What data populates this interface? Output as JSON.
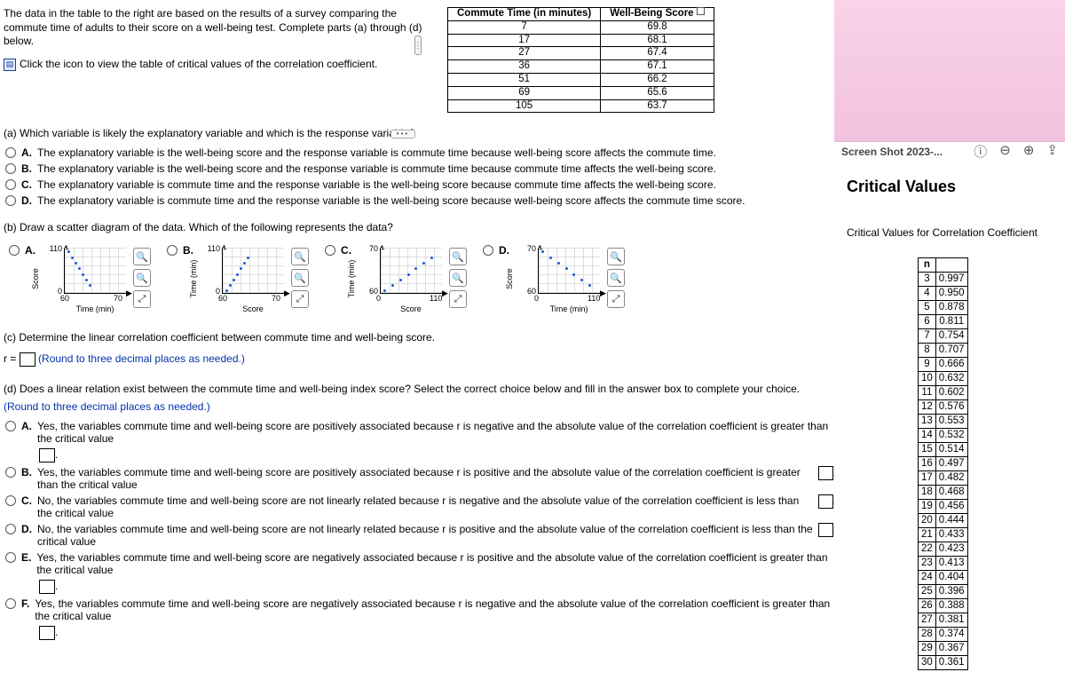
{
  "intro": {
    "line1": "The data in the table to the right are based on the results of a survey comparing the commute time of adults to their score on a well-being test. Complete parts (a) through (d) below.",
    "click_link": "Click the icon to view the table of critical values of the correlation coefficient."
  },
  "data_table": {
    "head_commute": "Commute Time (in minutes)",
    "head_score": "Well-Being Score",
    "rows": [
      {
        "c": "7",
        "s": "69.8"
      },
      {
        "c": "17",
        "s": "68.1"
      },
      {
        "c": "27",
        "s": "67.4"
      },
      {
        "c": "36",
        "s": "67.1"
      },
      {
        "c": "51",
        "s": "66.2"
      },
      {
        "c": "69",
        "s": "65.6"
      },
      {
        "c": "105",
        "s": "63.7"
      }
    ]
  },
  "qa": {
    "prompt": "(a) Which variable is likely the explanatory variable and which is the response variable?",
    "A": "The explanatory variable is the well-being score and the response variable is commute time because well-being score affects the commute time.",
    "B": "The explanatory variable is the well-being score and the response variable is commute time because commute time affects the well-being score.",
    "C": "The explanatory variable is commute time and the response variable is the well-being score because commute time affects the well-being score.",
    "D": "The explanatory variable is commute time and the response variable is the well-being score because well-being score affects the commute time score."
  },
  "qb": {
    "prompt": "(b) Draw a scatter diagram of the data. Which of the following represents the data?",
    "labA": "A.",
    "labB": "B.",
    "labC": "C.",
    "labD": "D.",
    "plotA": {
      "yl": "Score",
      "xl": "Time (min)",
      "yt": "110",
      "yb": "0",
      "xa": "60",
      "xb": "70"
    },
    "plotB": {
      "yl": "Time (min)",
      "xl": "Score",
      "yt": "110",
      "yb": "0",
      "xa": "60",
      "xb": "70"
    },
    "plotC": {
      "yl": "Time (min)",
      "xl": "Score",
      "yt": "70",
      "yb": "60",
      "xa": "0",
      "xb": "110"
    },
    "plotD": {
      "yl": "Score",
      "xl": "Time (min)",
      "yt": "70",
      "yb": "60",
      "xa": "0",
      "xb": "110"
    }
  },
  "qc": {
    "prompt": "(c) Determine the linear correlation coefficient between commute time and well-being score.",
    "r_label": "r =",
    "round_note": "(Round to three decimal places as needed.)"
  },
  "qd": {
    "prompt": "(d) Does a linear relation exist between the commute time and well-being index score? Select the correct choice below and fill in the answer box to complete your choice.",
    "round_note": "(Round to three decimal places as needed.)",
    "A": "Yes, the variables commute time and well-being score are positively associated because r is negative and the absolute value of the correlation coefficient is greater than the critical value",
    "B": "Yes, the variables commute time and well-being score are positively associated because r is positive and the absolute value of the correlation coefficient is greater than the critical value",
    "C": "No, the variables commute time and well-being score are not linearly related because r is negative and the absolute value of the correlation coefficient is less than the critical value",
    "D": "No, the variables commute time and well-being score are not linearly related because r is positive and the absolute value of the correlation coefficient is less than the critical value",
    "E": "Yes, the variables commute time and well-being score are negatively associated because r is positive and the absolute value of the correlation coefficient is greater than the critical value",
    "F": "Yes, the variables commute time and well-being score are negatively associated because r is negative and the absolute value of the correlation coefficient is greater than the critical value"
  },
  "overlay": {
    "filename": "Screen Shot 2023-...",
    "title": "Critical Values",
    "subtitle": "Critical Values for Correlation Coefficient",
    "head_n": "n",
    "rows": [
      {
        "n": "3",
        "v": "0.997"
      },
      {
        "n": "4",
        "v": "0.950"
      },
      {
        "n": "5",
        "v": "0.878"
      },
      {
        "n": "6",
        "v": "0.811"
      },
      {
        "n": "7",
        "v": "0.754"
      },
      {
        "n": "8",
        "v": "0.707"
      },
      {
        "n": "9",
        "v": "0.666"
      },
      {
        "n": "10",
        "v": "0.632"
      },
      {
        "n": "11",
        "v": "0.602"
      },
      {
        "n": "12",
        "v": "0.576"
      },
      {
        "n": "13",
        "v": "0.553"
      },
      {
        "n": "14",
        "v": "0.532"
      },
      {
        "n": "15",
        "v": "0.514"
      },
      {
        "n": "16",
        "v": "0.497"
      },
      {
        "n": "17",
        "v": "0.482"
      },
      {
        "n": "18",
        "v": "0.468"
      },
      {
        "n": "19",
        "v": "0.456"
      },
      {
        "n": "20",
        "v": "0.444"
      },
      {
        "n": "21",
        "v": "0.433"
      },
      {
        "n": "22",
        "v": "0.423"
      },
      {
        "n": "23",
        "v": "0.413"
      },
      {
        "n": "24",
        "v": "0.404"
      },
      {
        "n": "25",
        "v": "0.396"
      },
      {
        "n": "26",
        "v": "0.388"
      },
      {
        "n": "27",
        "v": "0.381"
      },
      {
        "n": "28",
        "v": "0.374"
      },
      {
        "n": "29",
        "v": "0.367"
      },
      {
        "n": "30",
        "v": "0.361"
      }
    ]
  },
  "chart_data": [
    {
      "type": "scatter",
      "title": "A",
      "xlabel": "Time (min)",
      "ylabel": "Score",
      "xlim": [
        60,
        70
      ],
      "ylim": [
        0,
        110
      ],
      "series": [
        {
          "name": "pts",
          "x": [
            60.5,
            61,
            61.5,
            62,
            62.5,
            63,
            63.5,
            64
          ],
          "y": [
            105,
            90,
            75,
            60,
            45,
            30,
            20,
            10
          ]
        }
      ]
    },
    {
      "type": "scatter",
      "title": "B",
      "xlabel": "Score",
      "ylabel": "Time (min)",
      "xlim": [
        60,
        70
      ],
      "ylim": [
        0,
        110
      ],
      "series": [
        {
          "name": "pts",
          "x": [
            60.5,
            61,
            61.5,
            62,
            62.5,
            63,
            63.5,
            64
          ],
          "y": [
            10,
            20,
            30,
            45,
            60,
            75,
            90,
            105
          ]
        }
      ]
    },
    {
      "type": "scatter",
      "title": "C",
      "xlabel": "Score",
      "ylabel": "Time (min)",
      "xlim": [
        0,
        110
      ],
      "ylim": [
        60,
        70
      ],
      "series": [
        {
          "name": "pts",
          "x": [
            10,
            20,
            30,
            45,
            60,
            75,
            90,
            105
          ],
          "y": [
            61,
            62,
            63,
            64,
            65,
            66,
            67,
            68
          ]
        }
      ]
    },
    {
      "type": "scatter",
      "title": "D",
      "xlabel": "Time (min)",
      "ylabel": "Score",
      "xlim": [
        0,
        110
      ],
      "ylim": [
        60,
        70
      ],
      "series": [
        {
          "name": "pts",
          "x": [
            7,
            17,
            27,
            36,
            51,
            69,
            105
          ],
          "y": [
            69.8,
            68.1,
            67.4,
            67.1,
            66.2,
            65.6,
            63.7
          ]
        }
      ]
    }
  ]
}
